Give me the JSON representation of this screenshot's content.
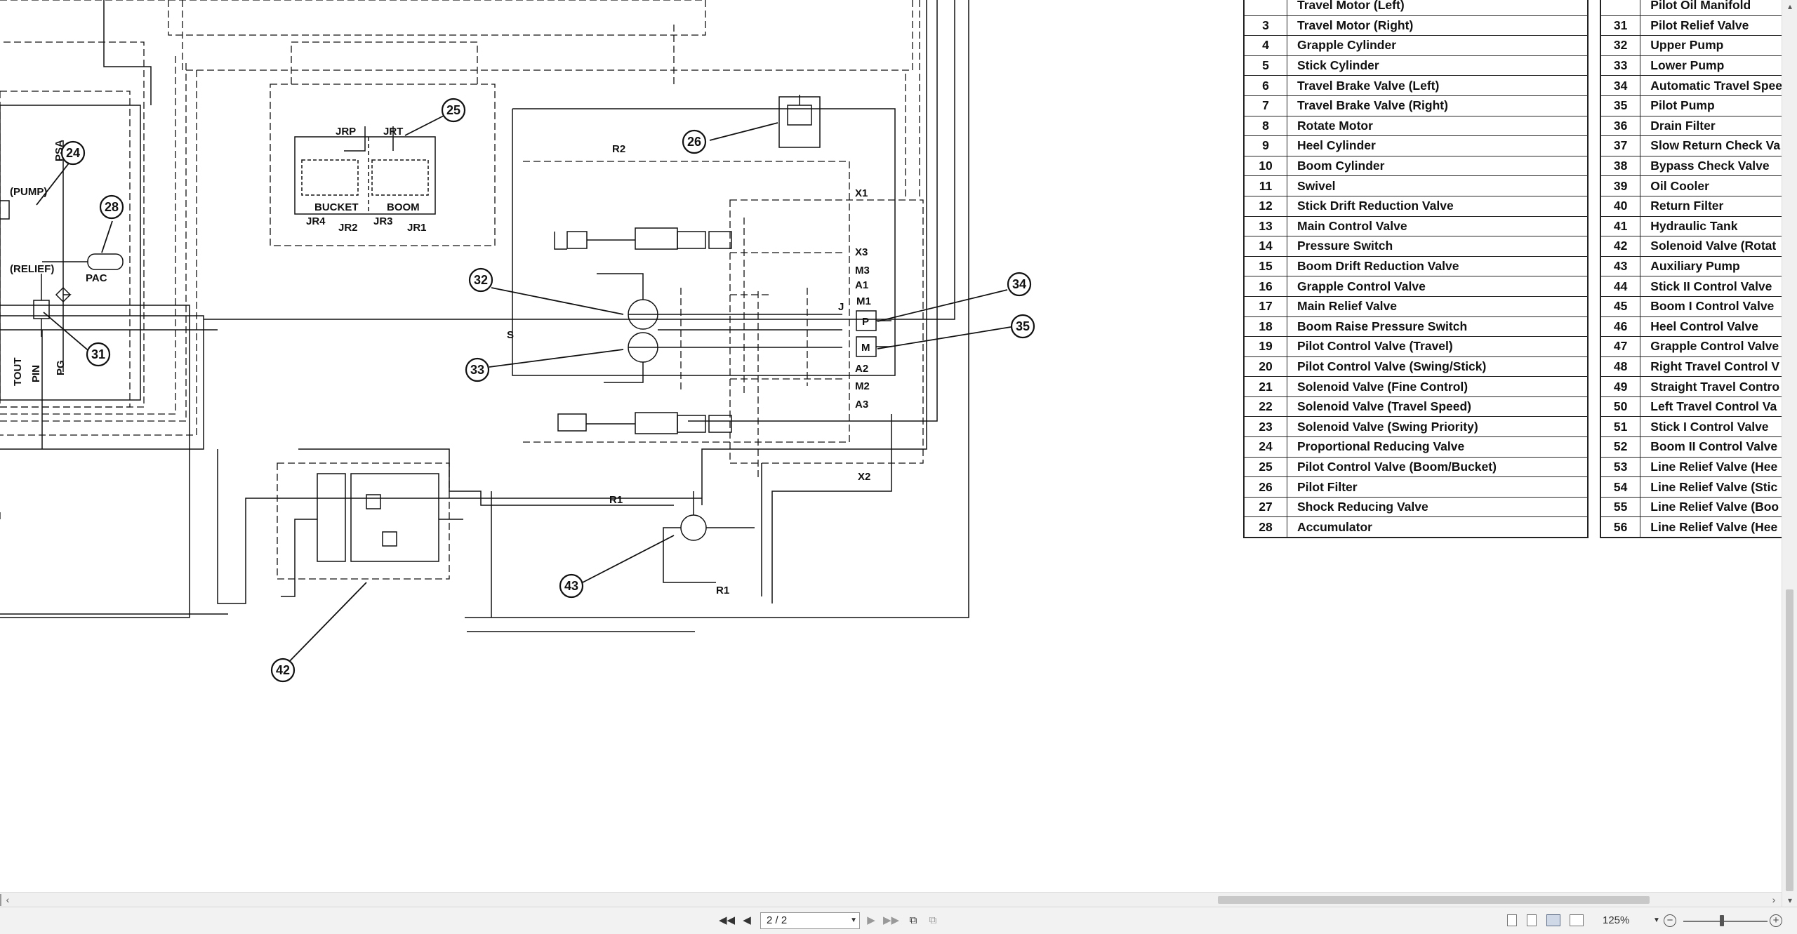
{
  "diagram": {
    "callouts": [
      "24",
      "25",
      "26",
      "28",
      "31",
      "32",
      "33",
      "34",
      "35",
      "42",
      "43"
    ],
    "labels": {
      "jrp": "JRP",
      "jrt": "JRT",
      "bucket": "BUCKET",
      "boom": "BOOM",
      "jr1": "JR1",
      "jr2": "JR2",
      "jr3": "JR3",
      "jr4": "JR4",
      "r1": "R1",
      "r2": "R2",
      "x1": "X1",
      "x2": "X2",
      "x3": "X3",
      "a1": "A1",
      "a2": "A2",
      "a3": "A3",
      "m1": "M1",
      "m2": "M2",
      "m3": "M3",
      "j": "J",
      "s": "S",
      "pac": "PAC",
      "pump": "(PUMP)",
      "relief": "(RELIEF)",
      "psa": "PSA",
      "tout": "TOUT",
      "pin": "PIN",
      "pg": "PG",
      "p_box": "P",
      "m_box": "M"
    }
  },
  "legend_left": [
    {
      "num": "",
      "name": "Travel Motor (Left)"
    },
    {
      "num": "3",
      "name": "Travel Motor (Right)"
    },
    {
      "num": "4",
      "name": "Grapple Cylinder"
    },
    {
      "num": "5",
      "name": "Stick Cylinder"
    },
    {
      "num": "6",
      "name": "Travel Brake Valve (Left)"
    },
    {
      "num": "7",
      "name": "Travel Brake Valve (Right)"
    },
    {
      "num": "8",
      "name": "Rotate Motor"
    },
    {
      "num": "9",
      "name": "Heel Cylinder"
    },
    {
      "num": "10",
      "name": "Boom Cylinder"
    },
    {
      "num": "11",
      "name": "Swivel"
    },
    {
      "num": "12",
      "name": "Stick Drift Reduction Valve"
    },
    {
      "num": "13",
      "name": "Main Control Valve"
    },
    {
      "num": "14",
      "name": "Pressure Switch"
    },
    {
      "num": "15",
      "name": "Boom Drift Reduction Valve"
    },
    {
      "num": "16",
      "name": "Grapple Control Valve"
    },
    {
      "num": "17",
      "name": "Main Relief Valve"
    },
    {
      "num": "18",
      "name": "Boom Raise Pressure Switch"
    },
    {
      "num": "19",
      "name": "Pilot Control Valve (Travel)"
    },
    {
      "num": "20",
      "name": "Pilot Control Valve (Swing/Stick)"
    },
    {
      "num": "21",
      "name": "Solenoid Valve (Fine Control)"
    },
    {
      "num": "22",
      "name": "Solenoid Valve (Travel Speed)"
    },
    {
      "num": "23",
      "name": "Solenoid Valve (Swing Priority)"
    },
    {
      "num": "24",
      "name": "Proportional Reducing Valve"
    },
    {
      "num": "25",
      "name": "Pilot Control Valve (Boom/Bucket)"
    },
    {
      "num": "26",
      "name": "Pilot Filter"
    },
    {
      "num": "27",
      "name": "Shock Reducing Valve"
    },
    {
      "num": "28",
      "name": "Accumulator"
    }
  ],
  "legend_right": [
    {
      "num": "",
      "name": "Pilot Oil Manifold"
    },
    {
      "num": "31",
      "name": "Pilot Relief Valve"
    },
    {
      "num": "32",
      "name": "Upper Pump"
    },
    {
      "num": "33",
      "name": "Lower Pump"
    },
    {
      "num": "34",
      "name": "Automatic Travel Spee"
    },
    {
      "num": "35",
      "name": "Pilot Pump"
    },
    {
      "num": "36",
      "name": "Drain Filter"
    },
    {
      "num": "37",
      "name": "Slow Return Check Va"
    },
    {
      "num": "38",
      "name": "Bypass Check Valve"
    },
    {
      "num": "39",
      "name": "Oil Cooler"
    },
    {
      "num": "40",
      "name": "Return Filter"
    },
    {
      "num": "41",
      "name": "Hydraulic Tank"
    },
    {
      "num": "42",
      "name": "Solenoid Valve (Rotat"
    },
    {
      "num": "43",
      "name": "Auxiliary Pump"
    },
    {
      "num": "44",
      "name": "Stick II Control Valve"
    },
    {
      "num": "45",
      "name": "Boom I Control Valve"
    },
    {
      "num": "46",
      "name": "Heel Control Valve"
    },
    {
      "num": "47",
      "name": "Grapple Control Valve"
    },
    {
      "num": "48",
      "name": "Right Travel Control V"
    },
    {
      "num": "49",
      "name": "Straight Travel Contro"
    },
    {
      "num": "50",
      "name": "Left Travel Control Va"
    },
    {
      "num": "51",
      "name": "Stick I Control Valve"
    },
    {
      "num": "52",
      "name": "Boom II Control Valve"
    },
    {
      "num": "53",
      "name": "Line Relief Valve (Hee"
    },
    {
      "num": "54",
      "name": "Line Relief Valve (Stic"
    },
    {
      "num": "55",
      "name": "Line Relief Valve (Boo"
    },
    {
      "num": "56",
      "name": "Line Relief Valve (Hee"
    }
  ],
  "statusbar": {
    "page": "2 / 2",
    "zoom": "125%",
    "zoom_level": 0.46,
    "icons": [
      "first-page-icon",
      "prev-page-icon",
      "next-page-icon",
      "last-page-icon",
      "single-page-icon",
      "continuous-icon",
      "facing-pages-icon",
      "facing-continuous-icon",
      "zoom-out-icon",
      "zoom-in-icon"
    ]
  }
}
